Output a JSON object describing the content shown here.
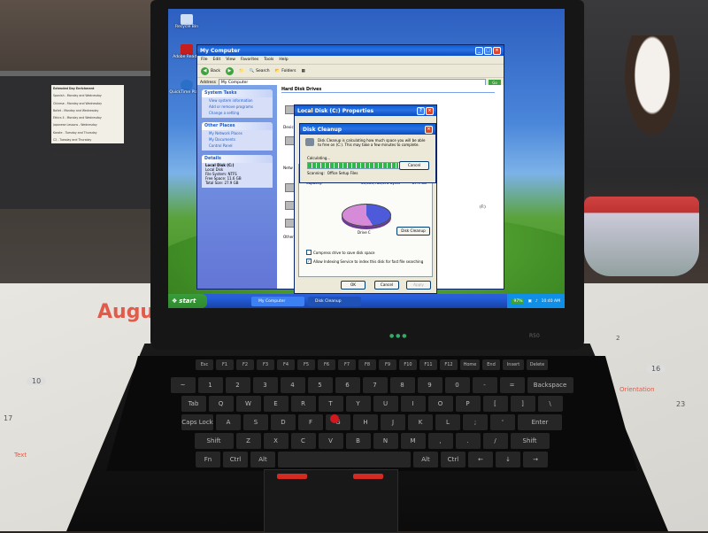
{
  "background": {
    "note_lines": [
      "Extended Day Enrichment",
      "Spanish - Monday and Wednesday",
      "Chinese - Monday and Wednesday",
      "Ballet - Monday and Wednesday",
      "Ethics II - Monday and Wednesday",
      "Japanese Lessons - Wednesday",
      "Karate - Tuesday and Thursday",
      "C2 - Tuesday and Thursday",
      "Lego - Tuesday and Thursday",
      "Soccer - Tuesday and Thursday"
    ],
    "calendar_month": "Augu",
    "calendar_dates": [
      "2",
      "10",
      "16",
      "17",
      "23"
    ],
    "calendar_events": [
      "Orientation",
      "Text"
    ]
  },
  "laptop": {
    "model": "R50",
    "colors": {
      "trackpoint": "#d4171e",
      "buttons": "#d42a22"
    }
  },
  "keyboard": {
    "row1": [
      "Esc",
      "F1",
      "F2",
      "F3",
      "F4",
      "F5",
      "F6",
      "F7",
      "F8",
      "F9",
      "F10",
      "F11",
      "F12",
      "Home",
      "End",
      "Insert",
      "Delete"
    ],
    "row2": [
      "~",
      "1",
      "2",
      "3",
      "4",
      "5",
      "6",
      "7",
      "8",
      "9",
      "0",
      "-",
      "=",
      "Backspace"
    ],
    "row3": [
      "Tab",
      "Q",
      "W",
      "E",
      "R",
      "T",
      "Y",
      "U",
      "I",
      "O",
      "P",
      "[",
      "]",
      "\\"
    ],
    "row4": [
      "Caps Lock",
      "A",
      "S",
      "D",
      "F",
      "G",
      "H",
      "J",
      "K",
      "L",
      ";",
      "'",
      "Enter"
    ],
    "row5": [
      "Shift",
      "Z",
      "X",
      "C",
      "V",
      "B",
      "N",
      "M",
      ",",
      ".",
      "/",
      "Shift"
    ],
    "row6": [
      "Fn",
      "Ctrl",
      "Alt",
      "",
      "Alt",
      "Ctrl",
      "←",
      "↓",
      "→"
    ]
  },
  "desktop": {
    "icons": [
      {
        "label": "Recycle Bin",
        "icon": "recycle-bin-icon"
      },
      {
        "label": "Adobe Reader",
        "icon": "adobe-reader-icon"
      },
      {
        "label": "QuickTime Player",
        "icon": "quicktime-icon"
      }
    ]
  },
  "my_computer": {
    "title": "My Computer",
    "menu": [
      "File",
      "Edit",
      "View",
      "Favorites",
      "Tools",
      "Help"
    ],
    "toolbar": {
      "back": "Back",
      "search": "Search",
      "folders": "Folders"
    },
    "address_label": "Address",
    "address_value": "My Computer",
    "go_label": "Go",
    "system_tasks": {
      "header": "System Tasks",
      "items": [
        "View system information",
        "Add or remove programs",
        "Change a setting"
      ]
    },
    "other_places": {
      "header": "Other Places",
      "items": [
        "My Network Places",
        "My Documents",
        "Control Panel"
      ]
    },
    "details": {
      "header": "Details",
      "name": "Local Disk (C:)",
      "type": "Local Disk",
      "fs": "File System: NTFS",
      "free": "Free Space: 11.6 GB",
      "total": "Total Size: 27.9 GB"
    },
    "section_title": "Hard Disk Drives",
    "partial_labels": [
      "Devic",
      "Netw",
      "Other"
    ],
    "side_fragment": "(F:)"
  },
  "properties": {
    "title": "Local Disk (C:) Properties",
    "free_label": "Free space:",
    "free_bytes": "12,467,475,200 bytes",
    "free_gb": "11.6 GB",
    "capacity_label": "Capacity:",
    "capacity_bytes": "30,005,788,672 bytes",
    "capacity_gb": "27.9 GB",
    "drive_label": "Drive C",
    "cleanup_button": "Disk Cleanup",
    "compress_label": "Compress drive to save disk space",
    "index_label": "Allow Indexing Service to index this disk for fast file searching",
    "ok": "OK",
    "cancel": "Cancel",
    "apply": "Apply",
    "chart": {
      "used_fraction": 0.59,
      "used_color": "#4d5ad9",
      "free_color": "#d58bd8"
    }
  },
  "disk_cleanup": {
    "title": "Disk Cleanup",
    "message": "Disk Cleanup is calculating how much space you will be able to free on (C:). This may take a few minutes to complete.",
    "calculating_label": "Calculating...",
    "cancel": "Cancel",
    "scanning_label": "Scanning:",
    "scanning_value": "Office Setup Files",
    "progress": 0.8
  },
  "taskbar": {
    "start": "start",
    "tasks": [
      "My Computer",
      "Disk Cleanup"
    ],
    "battery": "97%",
    "clock": "10:40 AM"
  }
}
